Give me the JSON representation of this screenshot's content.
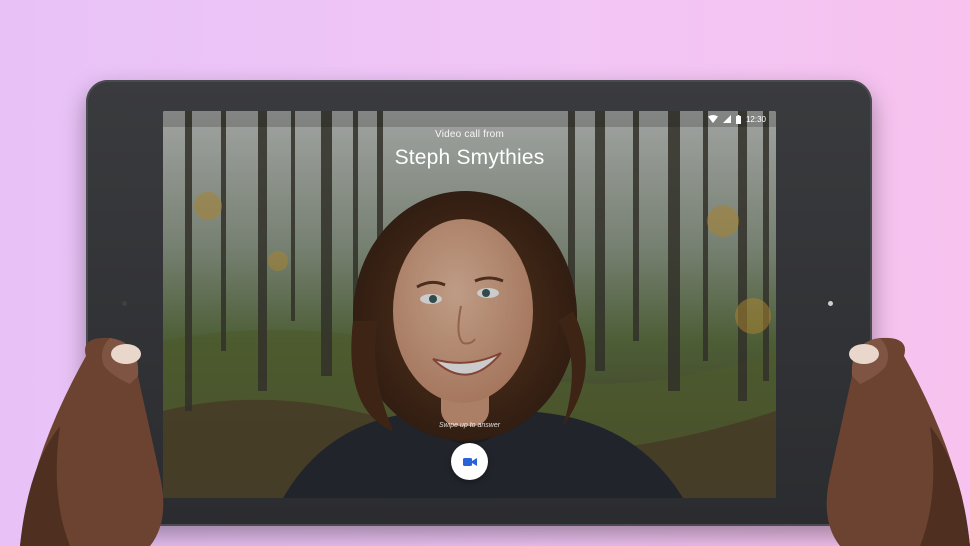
{
  "status_bar": {
    "time": "12:30",
    "icons": [
      "wifi-icon",
      "cell-signal-icon",
      "battery-icon"
    ]
  },
  "incoming_call": {
    "subtitle": "Video call from",
    "caller_name": "Steph Smythies",
    "swipe_hint": "Swipe up to answer",
    "answer_icon": "video-camera-icon",
    "accent_color": "#2a62d8"
  },
  "colors": {
    "background": "#f0c4f6",
    "tablet_body": "#2f3033"
  }
}
